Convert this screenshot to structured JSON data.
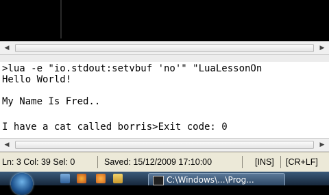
{
  "output": {
    "lines": [
      ">lua -e \"io.stdout:setvbuf 'no'\" \"LuaLessonOn",
      "Hello World!",
      "",
      "My Name Is Fred..",
      "",
      "I have a cat called borris>Exit code: 0"
    ]
  },
  "statusbar": {
    "position": "Ln: 3 Col: 39 Sel: 0",
    "saved": "Saved: 15/12/2009  17:10:00",
    "mode": "[INS]",
    "eol": "[CR+LF]"
  },
  "taskbar": {
    "task_label": "C:\\Windows\\...\\Prog..."
  },
  "icons": {
    "start": "windows-orb",
    "quicklaunch": [
      "show-desktop",
      "media-player",
      "firefox",
      "explorer"
    ]
  }
}
